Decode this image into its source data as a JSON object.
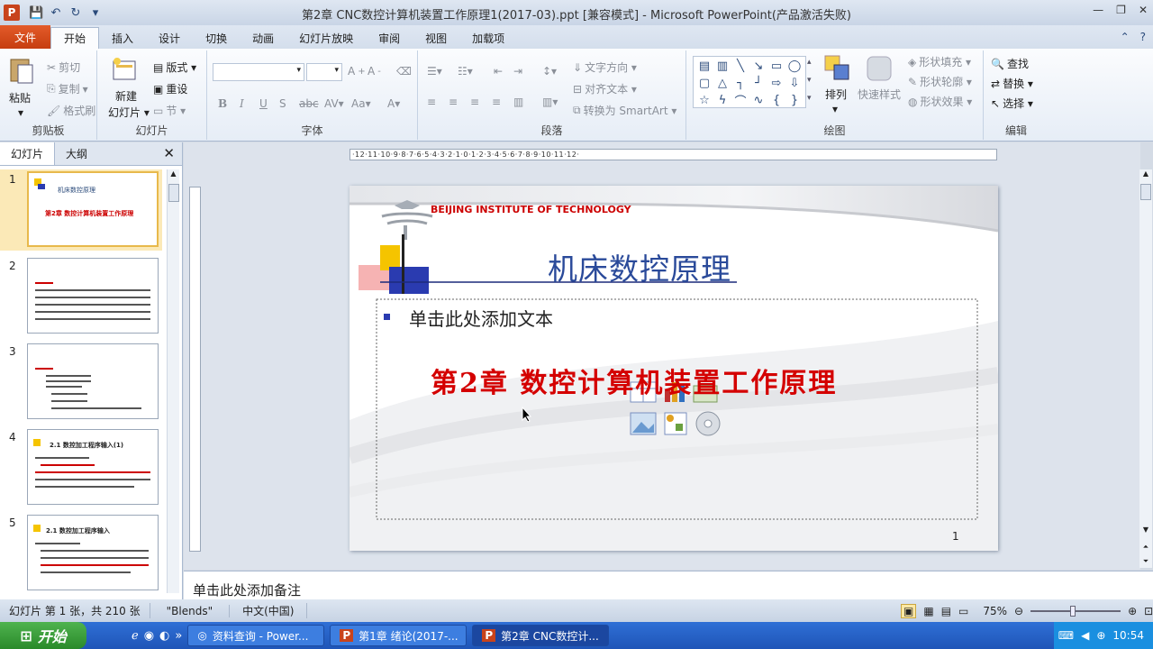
{
  "window": {
    "title": "第2章 CNC数控计算机装置工作原理1(2017-03).ppt [兼容模式]  -  Microsoft PowerPoint(产品激活失败)",
    "app_icon": "P"
  },
  "ribbon_tabs": [
    "文件",
    "开始",
    "插入",
    "设计",
    "切换",
    "动画",
    "幻灯片放映",
    "审阅",
    "视图",
    "加载项"
  ],
  "ribbon": {
    "clipboard": {
      "label": "剪贴板",
      "paste": "粘贴",
      "cut": "剪切",
      "copy": "复制",
      "format_painter": "格式刷"
    },
    "slides": {
      "label": "幻灯片",
      "new_slide_top": "新建",
      "new_slide_bottom": "幻灯片 ▾",
      "layout": "版式 ▾",
      "reset": "重设",
      "section": "节 ▾"
    },
    "font": {
      "label": "字体"
    },
    "paragraph": {
      "label": "段落",
      "text_direction": "文字方向 ▾",
      "align_text": "对齐文本 ▾",
      "smartart": "转换为 SmartArt ▾"
    },
    "drawing": {
      "label": "绘图",
      "arrange": "排列",
      "quick_styles": "快速样式",
      "shape_fill": "形状填充 ▾",
      "shape_outline": "形状轮廓 ▾",
      "shape_effects": "形状效果 ▾"
    },
    "editing": {
      "label": "编辑",
      "find": "查找",
      "replace": "替换 ▾",
      "select": "选择 ▾"
    }
  },
  "left_panel": {
    "tabs": [
      "幻灯片",
      "大纲"
    ],
    "slides": [
      {
        "num": "1",
        "title": "机床数控原理",
        "subtitle": "第2章 数控计算机装置工作原理"
      },
      {
        "num": "2"
      },
      {
        "num": "3"
      },
      {
        "num": "4",
        "title": "2.1 数控加工程序输入(1)"
      },
      {
        "num": "5",
        "title": "2.1 数控加工程序输入"
      }
    ]
  },
  "ruler_text": "·12·11·10·9·8·7·6·5·4·3·2·1·0·1·2·3·4·5·6·7·8·9·10·11·12·",
  "slide": {
    "institute": "BEIJING INSTITUTE OF TECHNOLOGY",
    "title": "机床数控原理",
    "placeholder": "单击此处添加文本",
    "chapter": "第2章  数控计算机装置工作原理",
    "page_number": "1"
  },
  "notes_placeholder": "单击此处添加备注",
  "status": {
    "slide_info": "幻灯片 第 1 张，共 210 张",
    "theme": "\"Blends\"",
    "language": "中文(中国)",
    "zoom": "75%"
  },
  "taskbar": {
    "start": "开始",
    "tasks": [
      "资料查询 - Power...",
      "第1章 绪论(2017-...",
      "第2章 CNC数控计..."
    ],
    "time": "10:54"
  },
  "colors": {
    "accent": "#c63d10",
    "title_blue": "#2a4a9a",
    "chapter_red": "#d40000"
  }
}
